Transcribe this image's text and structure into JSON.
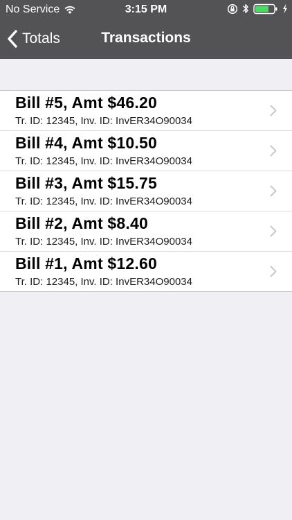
{
  "status_bar": {
    "carrier": "No Service",
    "time": "3:15 PM",
    "icons": [
      "wifi-icon",
      "orientation-lock-icon",
      "bluetooth-icon",
      "battery-icon",
      "charging-icon"
    ]
  },
  "nav": {
    "back_label": "Totals",
    "title": "Transactions"
  },
  "transactions": [
    {
      "title": "Bill #5, Amt $46.20",
      "subtitle": "Tr. ID: 12345, Inv. ID: InvER34O90034"
    },
    {
      "title": "Bill #4, Amt $10.50",
      "subtitle": "Tr. ID: 12345, Inv. ID: InvER34O90034"
    },
    {
      "title": "Bill #3, Amt $15.75",
      "subtitle": "Tr. ID: 12345, Inv. ID: InvER34O90034"
    },
    {
      "title": "Bill #2, Amt $8.40",
      "subtitle": "Tr. ID: 12345, Inv. ID: InvER34O90034"
    },
    {
      "title": "Bill #1, Amt $12.60",
      "subtitle": "Tr. ID: 12345, Inv. ID: InvER34O90034"
    }
  ],
  "colors": {
    "nav_background": "#535356",
    "page_background": "#efeff4",
    "battery_fill": "#4cd964"
  }
}
